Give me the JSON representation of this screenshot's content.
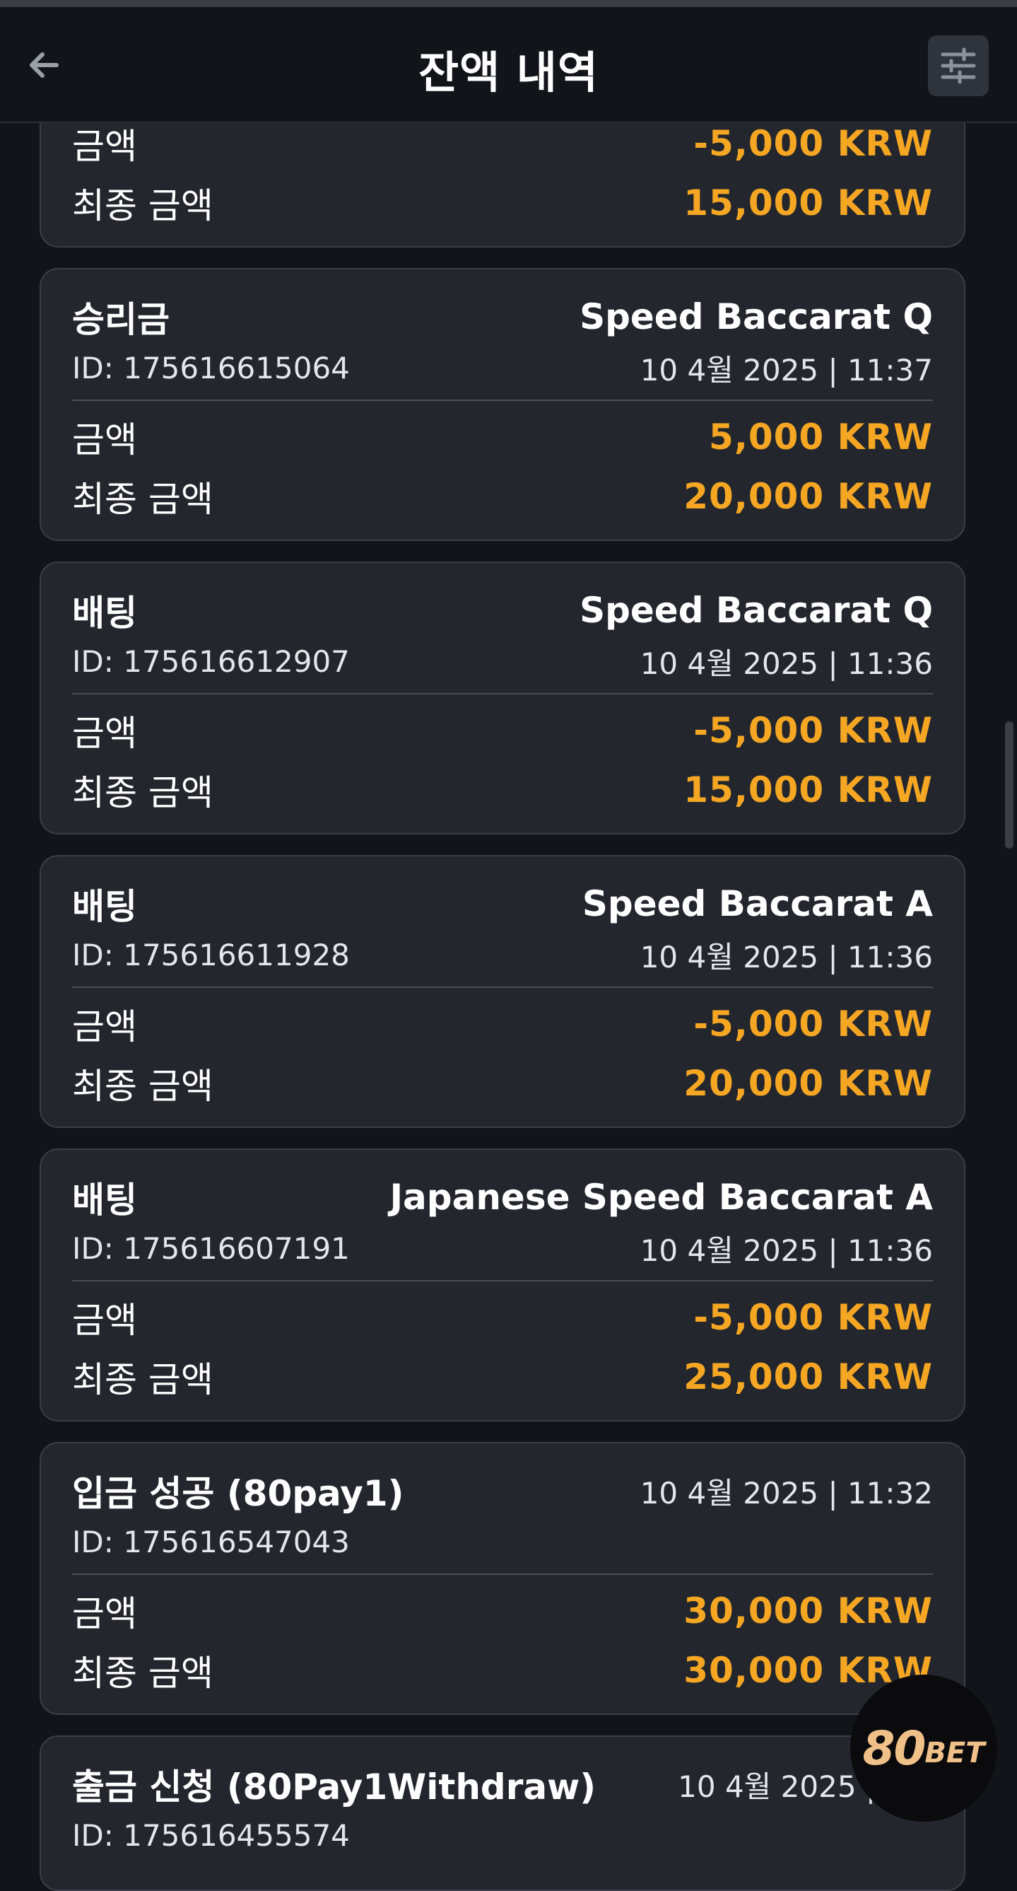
{
  "header": {
    "title": "잔액 내역",
    "back_icon": "arrow-left-icon",
    "filter_icon": "sliders-icon"
  },
  "labels": {
    "amount": "금액",
    "final_amount": "최종 금액"
  },
  "colors": {
    "accent": "#f5a623",
    "background": "#111419",
    "card": "#23262d"
  },
  "transactions": [
    {
      "amount": "-5,000 KRW",
      "final": "15,000 KRW"
    },
    {
      "type": "승리금",
      "game": "Speed Baccarat Q",
      "id": "ID: 175616615064",
      "date": "10 4월 2025 | 11:37",
      "amount": "5,000 KRW",
      "final": "20,000 KRW"
    },
    {
      "type": "배팅",
      "game": "Speed Baccarat Q",
      "id": "ID: 175616612907",
      "date": "10 4월 2025 | 11:36",
      "amount": "-5,000 KRW",
      "final": "15,000 KRW"
    },
    {
      "type": "배팅",
      "game": "Speed Baccarat A",
      "id": "ID: 175616611928",
      "date": "10 4월 2025 | 11:36",
      "amount": "-5,000 KRW",
      "final": "20,000 KRW"
    },
    {
      "type": "배팅",
      "game": "Japanese Speed Baccarat A",
      "id": "ID: 175616607191",
      "date": "10 4월 2025 | 11:36",
      "amount": "-5,000 KRW",
      "final": "25,000 KRW"
    },
    {
      "type": "입금 성공 (80pay1)",
      "id": "ID: 175616547043",
      "date": "10 4월 2025 | 11:32",
      "amount": "30,000 KRW",
      "final": "30,000 KRW"
    },
    {
      "type": "출금 신청 (80Pay1Withdraw)",
      "id": "ID: 175616455574",
      "date": "10 4월 2025 | 11:"
    }
  ],
  "brand": {
    "number": "80",
    "word": "BET"
  }
}
